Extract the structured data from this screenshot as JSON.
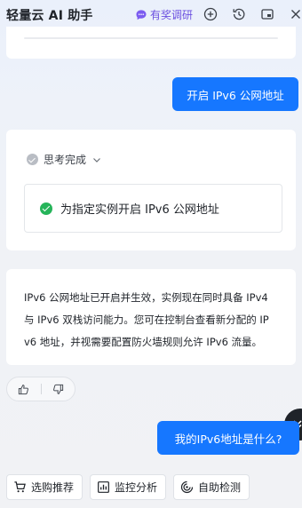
{
  "header": {
    "app_title": "轻量云 AI 助手",
    "survey_label": "有奖调研",
    "icons": [
      "add-circle-icon",
      "history-icon",
      "window-icon",
      "close-icon"
    ]
  },
  "messages": {
    "user_1": "开启 IPv6 公网地址",
    "thinking_status": "思考完成",
    "thinking_step": "为指定实例开启 IPv6 公网地址",
    "answer": "IPv6 公网地址已开启并生效，实例现在同时具备 IPv4\n与 IPv6 双栈访问能力。您可在控制台查看新分配的 IP\nv6 地址，并视需要配置防火墙规则允许 IPv6 流量。",
    "user_2": "我的IPv6地址是什么?"
  },
  "quick_actions": {
    "a1": "选购推荐",
    "a2": "监控分析",
    "a3": "自助检测"
  },
  "colors": {
    "primary": "#1677ff",
    "survey": "#6b4fe0",
    "success": "#26b45a"
  }
}
